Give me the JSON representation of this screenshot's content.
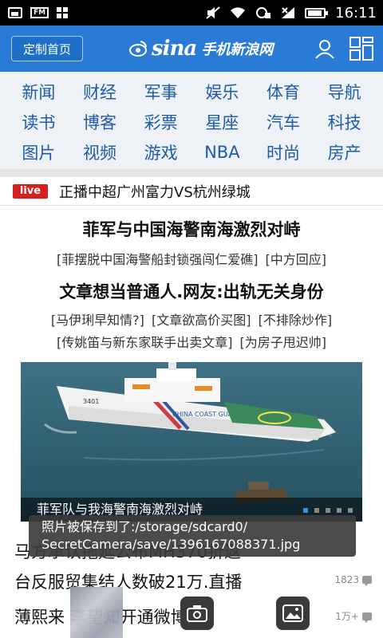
{
  "status_bar": {
    "time": "16:11",
    "fm_label": "FM"
  },
  "header": {
    "custom_home_label": "定制首页",
    "logo_brand": "sina",
    "logo_text": "手机新浪网"
  },
  "channels": [
    "新闻",
    "财经",
    "军事",
    "娱乐",
    "体育",
    "导航",
    "读书",
    "博客",
    "彩票",
    "星座",
    "汽车",
    "科技",
    "图片",
    "视频",
    "游戏",
    "NBA",
    "时尚",
    "房产"
  ],
  "live": {
    "badge": "live",
    "text": "正播中超广州富力VS杭州绿城"
  },
  "headline1": {
    "title": "菲军与中国海警南海激烈对峙",
    "links": [
      "[菲摆脱中国海警船封锁强闯仁爱礁]",
      "[中方回应]"
    ]
  },
  "headline2": {
    "title": "文章想当普通人.网友:出轨无关身份",
    "links_row1": [
      "[马伊琍早知情?]",
      "[文章欲高价买图]",
      "[不排除炒作]"
    ],
    "links_row2": [
      "[传姚笛与新东家联手出卖文章]",
      "[为房子甩迟帅]"
    ]
  },
  "photo": {
    "caption": "菲军队与我海警南海激烈对峙",
    "ship_text": "CHINA COAST GUARD",
    "ship_number": "3401",
    "slides": 5,
    "active_slide": 1
  },
  "toast": {
    "line1": "照片被保存到了:/storage/sdcard0/",
    "line2": "SecretCamera/save/1396167088371.jpg"
  },
  "news": [
    {
      "title": "马方承认拖延公布MH370折返",
      "comments": ""
    },
    {
      "title": "台反服贸集结人数破21万.直播",
      "comments": "1823"
    },
    {
      "title": "薄熙来       李望知开通微博",
      "comments": "1万+"
    }
  ],
  "colors": {
    "header_blue": "#2a7bd6",
    "channel_blue": "#1f5ba8",
    "live_red": "#d81e1e"
  }
}
